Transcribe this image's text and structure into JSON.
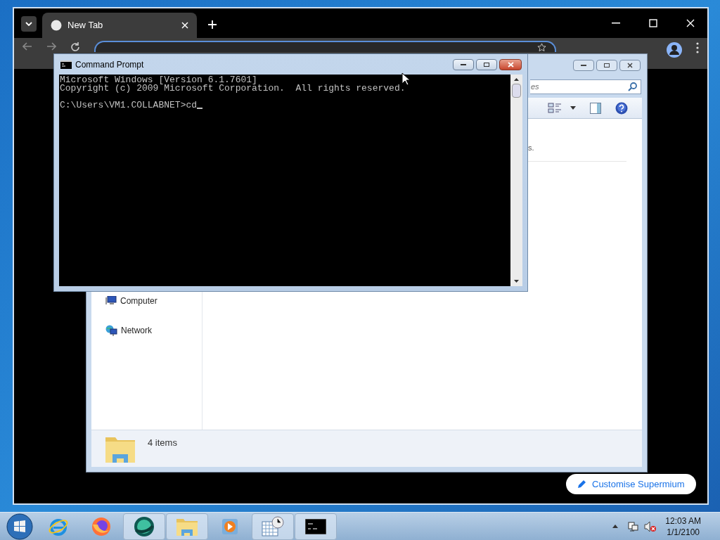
{
  "browser": {
    "tab": {
      "title": "New Tab",
      "selected": true
    },
    "customise_button": "Customise Supermium"
  },
  "explorer": {
    "search_text": "es",
    "content_text": "s.",
    "nav_items": [
      {
        "kind": "computer",
        "label": "Computer"
      },
      {
        "kind": "network",
        "label": "Network"
      }
    ],
    "status": "4 items"
  },
  "console": {
    "title": "Command Prompt",
    "output": [
      "Microsoft Windows [Version 6.1.7601]",
      "Copyright (c) 2009 Microsoft Corporation.  All rights reserved."
    ],
    "prompt": "C:\\Users\\VM1.COLLABNET>cd"
  },
  "taskbar": {
    "apps": [
      {
        "kind": "ie",
        "running": false
      },
      {
        "kind": "firefox",
        "running": false
      },
      {
        "kind": "orb",
        "running": true
      },
      {
        "kind": "folder",
        "running": true
      },
      {
        "kind": "media",
        "running": false
      },
      {
        "kind": "calendar",
        "running": true
      },
      {
        "kind": "console",
        "running": true
      }
    ],
    "time": "12:03 AM",
    "date": "1/1/2100"
  }
}
